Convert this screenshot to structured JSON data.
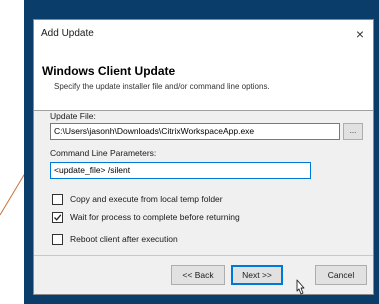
{
  "window": {
    "title": "Add Update",
    "close_glyph": "×"
  },
  "header": {
    "title": "Windows Client Update",
    "subtitle": "Specify the update installer file and/or command line options."
  },
  "update_file": {
    "label": "Update File:",
    "value": "C:\\Users\\jasonh\\Downloads\\CitrixWorkspaceApp.exe",
    "browse_label": "..."
  },
  "command_line": {
    "label": "Command Line Parameters:",
    "value": "<update_file> /silent"
  },
  "options": [
    {
      "label": "Copy and execute from local temp folder",
      "checked": false
    },
    {
      "label": "Wait for process to complete before returning",
      "checked": true
    },
    {
      "label": "Reboot client after execution",
      "checked": false
    }
  ],
  "buttons": {
    "back": "<< Back",
    "next": "Next >>",
    "cancel": "Cancel"
  },
  "colors": {
    "frame": "#0a3d6a",
    "dialog_bg": "#f0f0f0",
    "focus_border": "#0078d7",
    "accent_line": "#c8743a"
  },
  "icons": {
    "close": "close-icon",
    "cursor": "mouse-pointer-icon",
    "check": "checkmark-icon"
  }
}
